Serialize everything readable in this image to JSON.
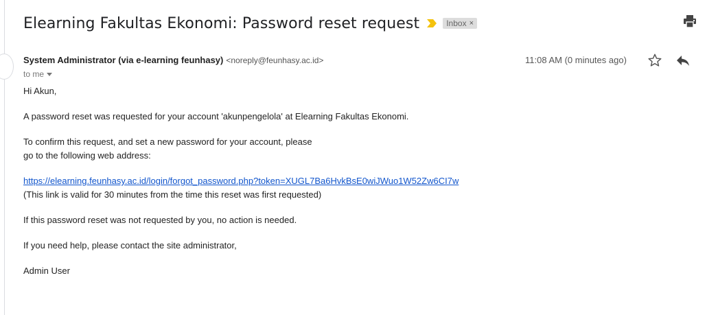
{
  "email": {
    "subject": "Elearning Fakultas Ekonomi: Password reset request",
    "label": "Inbox",
    "label_close": "×",
    "sender_name": "System Administrator (via e-learning feunhasy)",
    "sender_email": "<noreply@feunhasy.ac.id>",
    "time": "11:08 AM (0 minutes ago)",
    "recipient": "to me",
    "greeting": "Hi Akun,",
    "para1": "A password reset was requested for your account 'akunpengelola' at Elearning Fakultas Ekonomi.",
    "para2_line1": "To confirm this request, and set a new password for your account, please",
    "para2_line2": "go to the following web address:",
    "link": "https://elearning.feunhasy.ac.id/login/forgot_password.php?token=XUGL7Ba6HvkBsE0wiJWuo1W52Zw6CI7w",
    "link_note": "(This link is valid for 30 minutes from the time this reset was first requested)",
    "para4": "If this password reset was not requested by you, no action is needed.",
    "para5": "If you need help, please contact the site administrator,",
    "signature": "Admin User"
  },
  "icons": {
    "importance": "importance-marker-icon",
    "print": "print-icon",
    "star": "star-icon",
    "reply": "reply-icon",
    "dropdown": "chevron-down-icon"
  },
  "colors": {
    "importance": "#f4c20d",
    "link": "#1155cc",
    "label_bg": "#dddddd"
  }
}
